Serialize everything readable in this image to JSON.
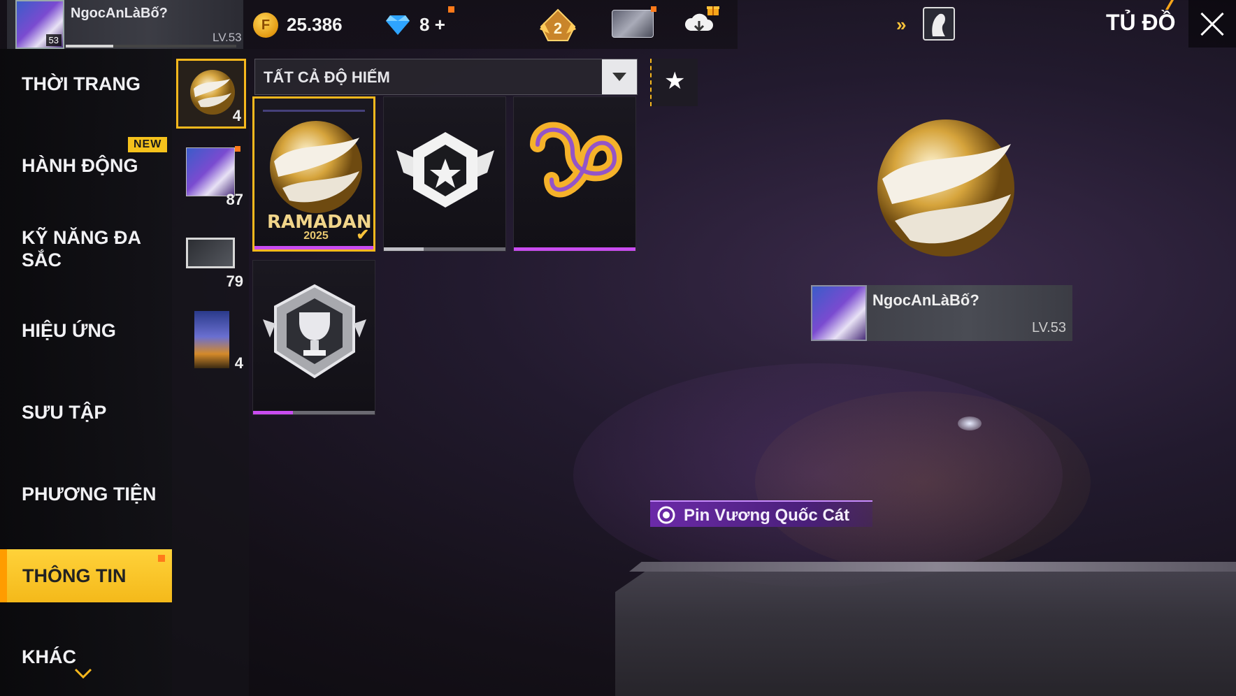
{
  "profile": {
    "name": "NgocAnLàBố?",
    "avatar_level": "53",
    "level_label": "LV.53",
    "xp_progress": 0.28
  },
  "currency": {
    "coins": "25.386",
    "diamonds": "8",
    "diamonds_add": "+"
  },
  "header": {
    "rank_badge": "2",
    "title": "TỦ ĐỒ"
  },
  "menu": {
    "new_badge": "NEW",
    "items": [
      {
        "label": "THỜI TRANG"
      },
      {
        "label": "HÀNH ĐỘNG"
      },
      {
        "label": "KỸ NĂNG ĐA SẮC"
      },
      {
        "label": "HIỆU ỨNG"
      },
      {
        "label": "SƯU TẬP"
      },
      {
        "label": "PHƯƠNG TIỆN"
      },
      {
        "label": "THÔNG TIN"
      },
      {
        "label": "KHÁC"
      }
    ],
    "active_index": 6
  },
  "subcategories": [
    {
      "count": "4"
    },
    {
      "count": "87"
    },
    {
      "count": "79"
    },
    {
      "count": "4"
    }
  ],
  "filter": {
    "label": "TẤT CẢ ĐỘ HIẾM"
  },
  "grid": {
    "items": [
      {
        "name": "Pin Vương Quốc Cát",
        "text": "RAMADAN",
        "year": "2025",
        "rarity_color": "#c94cf0"
      },
      {
        "rarity_color": "#9a9aa4"
      },
      {
        "rarity_color": "#c94cf0"
      },
      {
        "rarity_color": "#c94cf0"
      }
    ]
  },
  "preview": {
    "card_name": "NgocAnLàBố?",
    "card_level": "LV.53",
    "item_label": "Pin Vương Quốc Cát"
  },
  "colors": {
    "accent": "#f7b81d",
    "rarity_purple": "#c94cf0",
    "menu_active": "#ffd23a"
  }
}
